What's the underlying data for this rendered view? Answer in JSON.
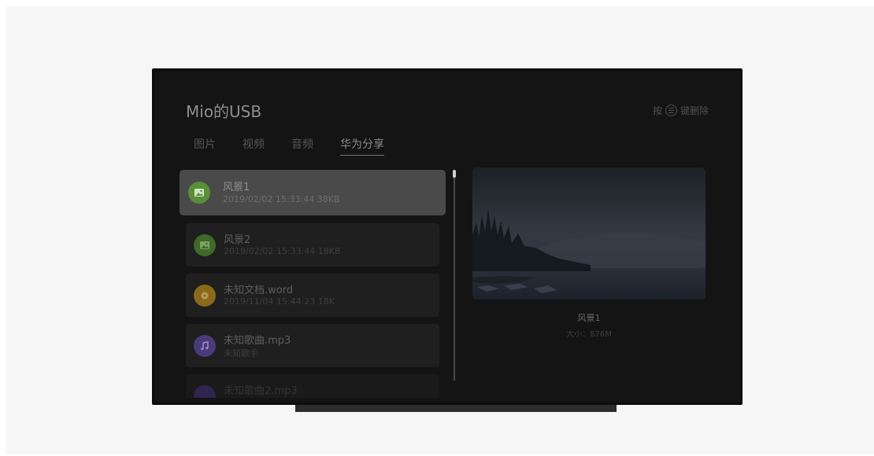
{
  "app": {
    "title": "Mio的USB"
  },
  "hint": {
    "prefix": "按",
    "suffix": "键删除"
  },
  "tabs": [
    {
      "label": "图片",
      "active": false
    },
    {
      "label": "视频",
      "active": false
    },
    {
      "label": "音频",
      "active": false
    },
    {
      "label": "华为分享",
      "active": true
    }
  ],
  "files": [
    {
      "name": "风景1",
      "meta": "2019/02/02 15:33:44 38KB",
      "type": "image",
      "selected": true,
      "icon_color": "#5a8f3a"
    },
    {
      "name": "风景2",
      "meta": "2019/02/02 15:33:44 18KB",
      "type": "image",
      "selected": false,
      "icon_color": "#3f6a2a"
    },
    {
      "name": "未知文档.word",
      "meta": "2019/11/04 15:44:23 18K",
      "type": "document",
      "selected": false,
      "icon_color": "#8a6a1a"
    },
    {
      "name": "未知歌曲.mp3",
      "meta": "未知歌手",
      "type": "audio",
      "selected": false,
      "icon_color": "#4a3a7a"
    },
    {
      "name": "未知歌曲2.mp3",
      "meta": "",
      "type": "audio",
      "selected": false,
      "icon_color": "#2e2550"
    }
  ],
  "preview": {
    "name": "风景1",
    "size": "大小：876M"
  },
  "colors": {
    "background": "#f6f6f6",
    "screen": "#141414",
    "selected": "#4a4a4a"
  }
}
